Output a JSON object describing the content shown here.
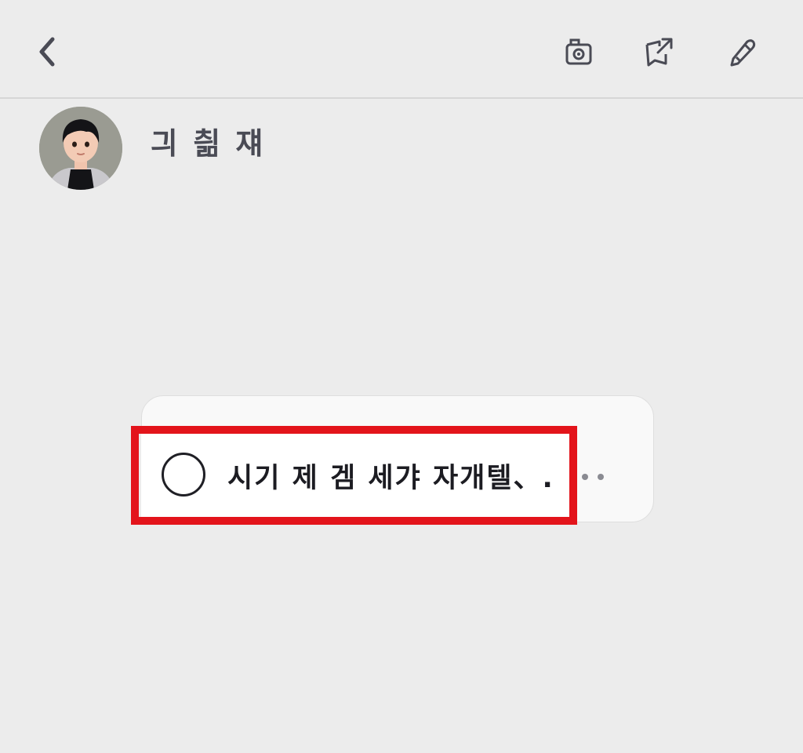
{
  "header": {
    "back_icon": "chevron-left-icon",
    "camera_icon": "camera-icon",
    "share_icon": "share-export-icon",
    "edit_icon": "pencil-edit-icon"
  },
  "profile": {
    "name": "긔 칆 쟤",
    "avatar": "user-avatar"
  },
  "task": {
    "text": "시기 제 겜 세갸 자개텔、.",
    "checked": false,
    "overflow": "more-dots"
  },
  "colors": {
    "background": "#ececec",
    "highlight": "#e3141b",
    "icon": "#4a4b55"
  }
}
